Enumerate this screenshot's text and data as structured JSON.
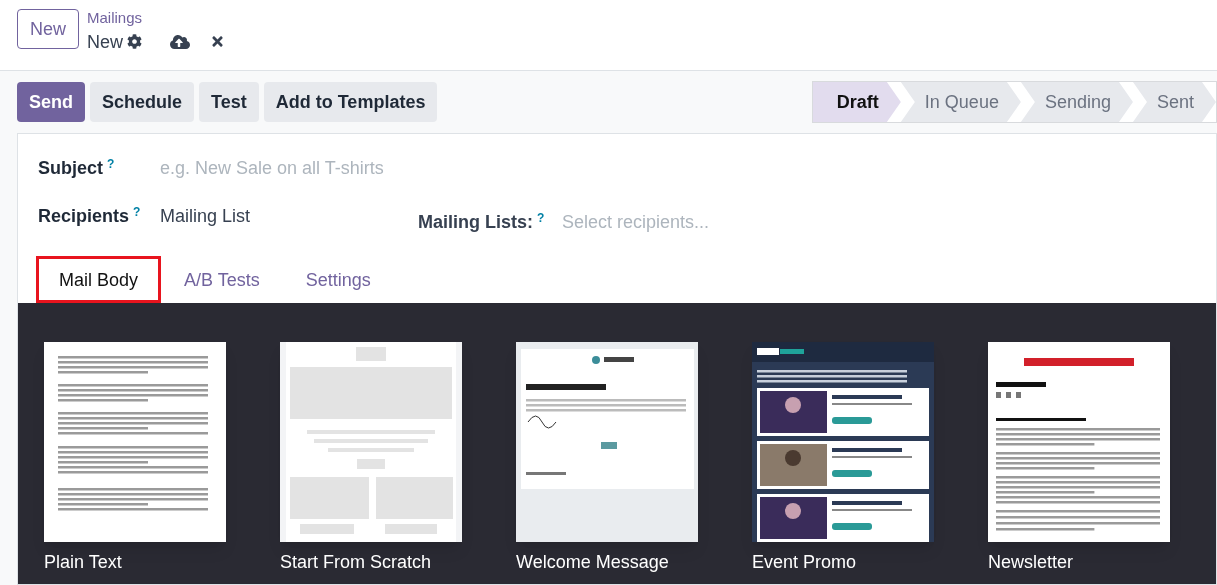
{
  "header": {
    "new_button": "New",
    "breadcrumb": "Mailings",
    "record": "New"
  },
  "actions": [
    {
      "label": "Send",
      "kind": "primary"
    },
    {
      "label": "Schedule",
      "kind": "secondary"
    },
    {
      "label": "Test",
      "kind": "secondary"
    },
    {
      "label": "Add to Templates",
      "kind": "secondary"
    }
  ],
  "stages": [
    {
      "label": "Draft",
      "selected": true
    },
    {
      "label": "In Queue",
      "selected": false
    },
    {
      "label": "Sending",
      "selected": false
    },
    {
      "label": "Sent",
      "selected": false
    }
  ],
  "form": {
    "subject": {
      "label": "Subject",
      "help": "?",
      "placeholder": "e.g. New Sale on all T-shirts"
    },
    "recipients": {
      "label": "Recipients",
      "help": "?",
      "value": "Mailing List"
    },
    "mailing_lists": {
      "label": "Mailing Lists:",
      "help": "?",
      "placeholder": "Select recipients..."
    }
  },
  "tabs": [
    {
      "label": "Mail Body",
      "selected": true,
      "highlighted": true
    },
    {
      "label": "A/B Tests",
      "selected": false,
      "highlighted": false
    },
    {
      "label": "Settings",
      "selected": false,
      "highlighted": false
    }
  ],
  "templates": [
    {
      "name": "Plain Text",
      "kind": "picture"
    },
    {
      "name": "Start From Scratch",
      "kind": "picture"
    },
    {
      "name": "Welcome Message",
      "kind": "picture"
    },
    {
      "name": "Event Promo",
      "kind": "picture"
    },
    {
      "name": "Newsletter",
      "kind": "picture"
    }
  ]
}
